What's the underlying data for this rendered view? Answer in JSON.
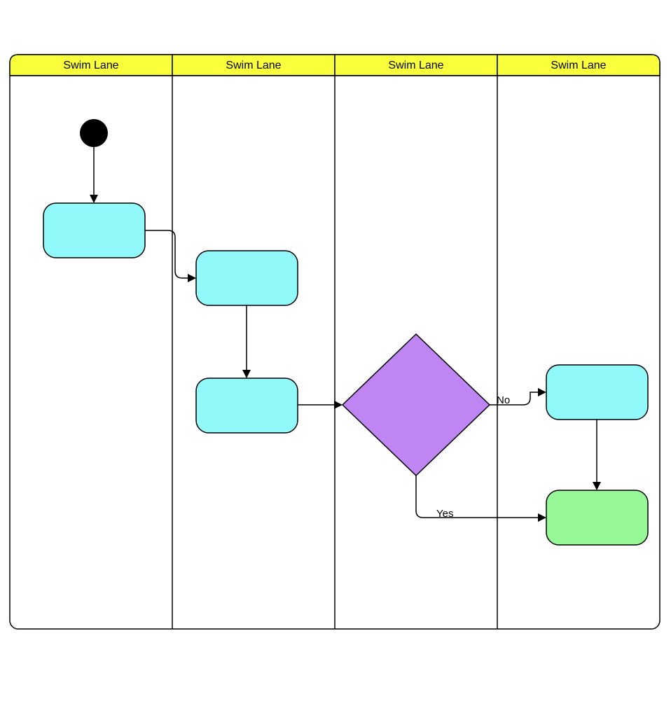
{
  "lanes": {
    "l1": {
      "label": "Swim Lane"
    },
    "l2": {
      "label": "Swim Lane"
    },
    "l3": {
      "label": "Swim Lane"
    },
    "l4": {
      "label": "Swim Lane"
    }
  },
  "branches": {
    "yes": "Yes",
    "no": "No"
  }
}
